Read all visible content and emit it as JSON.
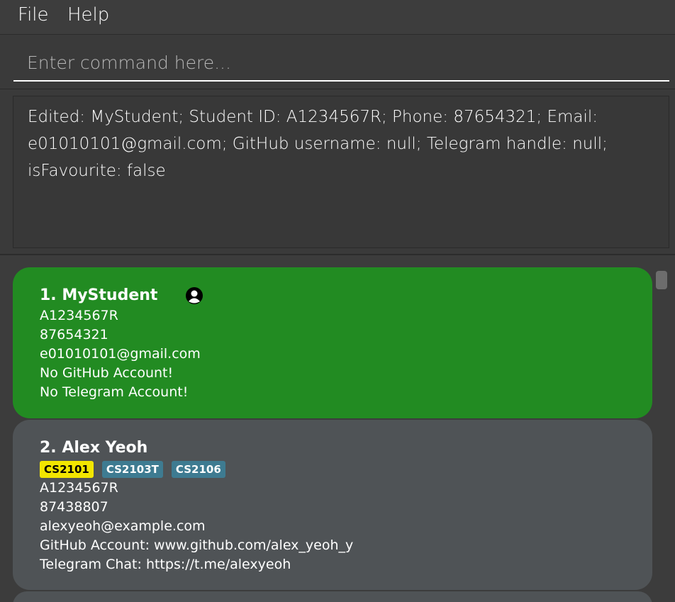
{
  "menu": {
    "file": "File",
    "help": "Help"
  },
  "command": {
    "placeholder": "Enter command here..."
  },
  "result": {
    "text": "Edited: MyStudent; Student ID: A1234567R; Phone: 87654321; Email: e01010101@gmail.com; GitHub username: null; Telegram handle: null; isFavourite: false"
  },
  "students": [
    {
      "name": "1. MyStudent",
      "avatar_icon": "user-avatar-icon",
      "student_id": "A1234567R",
      "phone": "87654321",
      "email": "e01010101@gmail.com",
      "github": "No GitHub Account!",
      "telegram": "No Telegram Account!",
      "tags": []
    },
    {
      "name": "2. Alex Yeoh",
      "student_id": "A1234567R",
      "phone": "87438807",
      "email": "alexyeoh@example.com",
      "github": "GitHub Account: www.github.com/alex_yeoh_y",
      "telegram": "Telegram Chat: https://t.me/alexyeoh",
      "tags": [
        {
          "label": "CS2101",
          "bg": "#f2e600",
          "fg": "#000000"
        },
        {
          "label": "CS2103T",
          "bg": "#3e7b91",
          "fg": "#ffffff"
        },
        {
          "label": "CS2106",
          "bg": "#3e7b91",
          "fg": "#ffffff"
        }
      ]
    }
  ],
  "colors": {
    "selected_card": "#228b22",
    "normal_card": "#4f5356",
    "background": "#3a3a3a"
  }
}
